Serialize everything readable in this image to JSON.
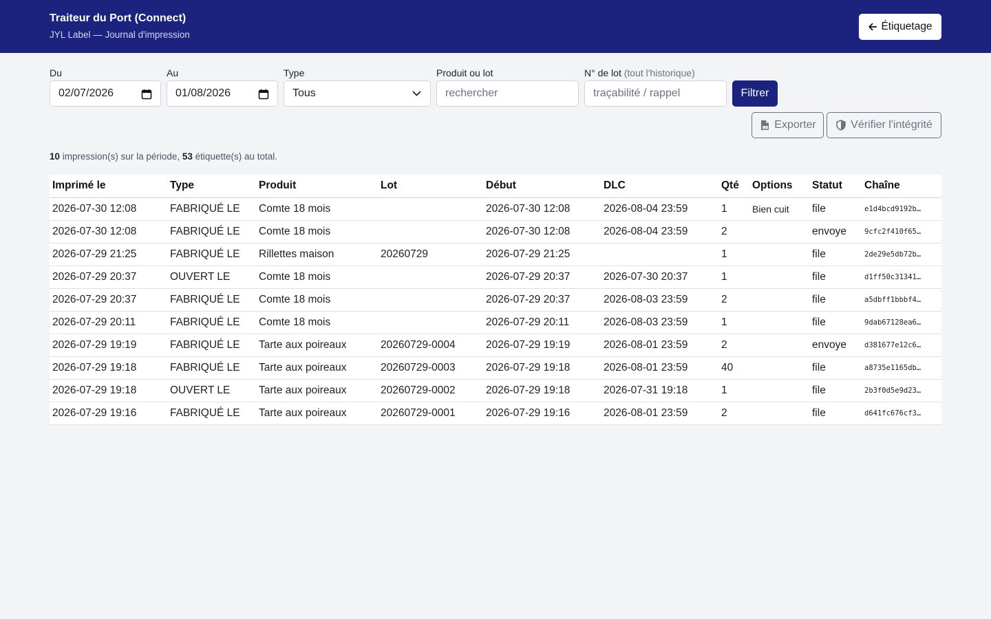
{
  "header": {
    "title": "Traiteur du Port (Connect)",
    "subtitle": "JYL Label — Journal d'impression",
    "back_label": "Étiquetage"
  },
  "filters": {
    "from_label": "Du",
    "from_value": "02/07/2026",
    "to_label": "Au",
    "to_value": "01/08/2026",
    "type_label": "Type",
    "type_value": "Tous",
    "search_label": "Produit ou lot",
    "search_placeholder": "rechercher",
    "lot_label": "N° de lot",
    "lot_label_hint": "(tout l'historique)",
    "lot_placeholder": "traçabilité / rappel",
    "filter_button": "Filtrer",
    "export_button": "Exporter",
    "verify_button": "Vérifier l'intégrité"
  },
  "summary": {
    "print_count": "10",
    "print_text": "impression(s) sur la période,",
    "label_count": "53",
    "label_text": "étiquette(s) au total."
  },
  "table": {
    "columns": [
      "Imprimé le",
      "Type",
      "Produit",
      "Lot",
      "Début",
      "DLC",
      "Qté",
      "Options",
      "Statut",
      "Chaîne"
    ],
    "rows": [
      [
        "2026-07-30 12:08",
        "FABRIQUÉ LE",
        "Comte 18 mois",
        "",
        "2026-07-30 12:08",
        "2026-08-04 23:59",
        "1",
        "Bien cuit",
        "file",
        "e1d4bcd9192b…"
      ],
      [
        "2026-07-30 12:08",
        "FABRIQUÉ LE",
        "Comte 18 mois",
        "",
        "2026-07-30 12:08",
        "2026-08-04 23:59",
        "2",
        "",
        "envoye",
        "9cfc2f410f65…"
      ],
      [
        "2026-07-29 21:25",
        "FABRIQUÉ LE",
        "Rillettes maison",
        "20260729",
        "2026-07-29 21:25",
        "",
        "1",
        "",
        "file",
        "2de29e5db72b…"
      ],
      [
        "2026-07-29 20:37",
        "OUVERT LE",
        "Comte 18 mois",
        "",
        "2026-07-29 20:37",
        "2026-07-30 20:37",
        "1",
        "",
        "file",
        "d1ff50c31341…"
      ],
      [
        "2026-07-29 20:37",
        "FABRIQUÉ LE",
        "Comte 18 mois",
        "",
        "2026-07-29 20:37",
        "2026-08-03 23:59",
        "2",
        "",
        "file",
        "a5dbff1bbbf4…"
      ],
      [
        "2026-07-29 20:11",
        "FABRIQUÉ LE",
        "Comte 18 mois",
        "",
        "2026-07-29 20:11",
        "2026-08-03 23:59",
        "1",
        "",
        "file",
        "9dab67128ea6…"
      ],
      [
        "2026-07-29 19:19",
        "FABRIQUÉ LE",
        "Tarte aux poireaux",
        "20260729-0004",
        "2026-07-29 19:19",
        "2026-08-01 23:59",
        "2",
        "",
        "envoye",
        "d381677e12c6…"
      ],
      [
        "2026-07-29 19:18",
        "FABRIQUÉ LE",
        "Tarte aux poireaux",
        "20260729-0003",
        "2026-07-29 19:18",
        "2026-08-01 23:59",
        "40",
        "",
        "file",
        "a8735e1165db…"
      ],
      [
        "2026-07-29 19:18",
        "OUVERT LE",
        "Tarte aux poireaux",
        "20260729-0002",
        "2026-07-29 19:18",
        "2026-07-31 19:18",
        "1",
        "",
        "file",
        "2b3f0d5e9d23…"
      ],
      [
        "2026-07-29 19:16",
        "FABRIQUÉ LE",
        "Tarte aux poireaux",
        "20260729-0001",
        "2026-07-29 19:16",
        "2026-08-01 23:59",
        "2",
        "",
        "file",
        "d641fc676cf3…"
      ]
    ]
  },
  "colors": {
    "header_bg": "#1b237e",
    "primary_button": "#1b237e",
    "page_bg": "#f3f4f6"
  },
  "icons": {
    "back": "arrow-left-icon",
    "calendar": "calendar-icon",
    "select": "chevron-down-icon",
    "export": "file-csv-icon",
    "verify": "shield-icon"
  }
}
